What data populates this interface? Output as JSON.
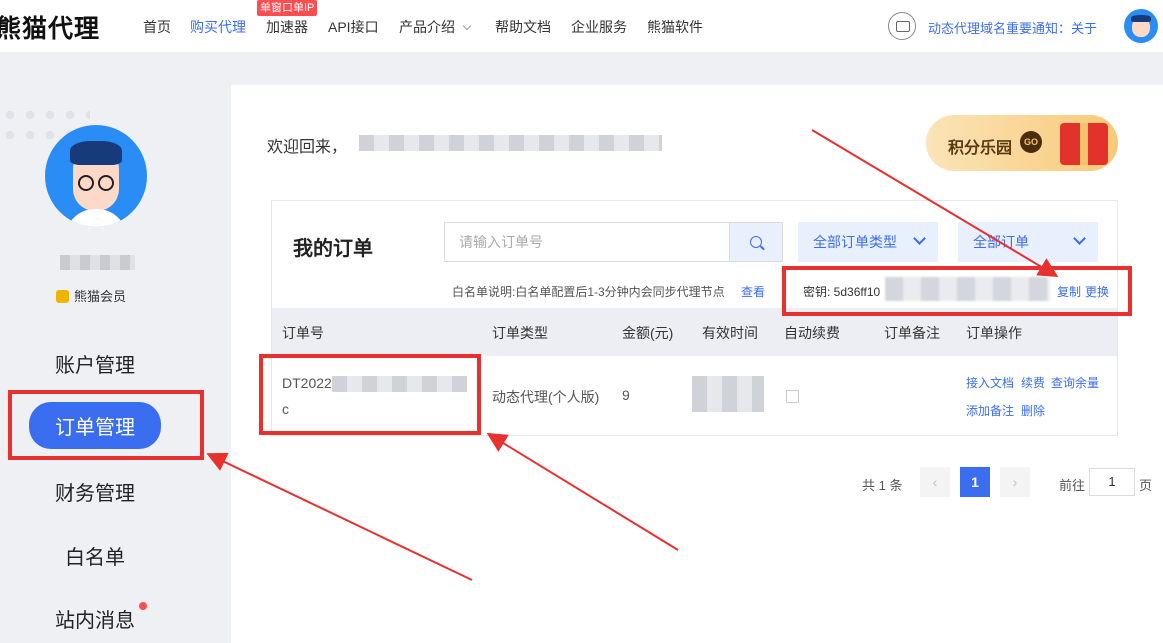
{
  "header": {
    "logo": "熊猫代理",
    "nav": [
      {
        "label": "首页"
      },
      {
        "label": "购买代理"
      },
      {
        "label": "加速器"
      },
      {
        "label": "API接口"
      },
      {
        "label": "产品介绍"
      },
      {
        "label": "帮助文档"
      },
      {
        "label": "企业服务"
      },
      {
        "label": "熊猫软件"
      }
    ],
    "nav_badge": "单窗口单IP",
    "notice": "动态代理域名重要通知：关于",
    "accent_color": "#3a6df0"
  },
  "sidebar": {
    "member_label": "熊猫会员",
    "menu": [
      {
        "label": "账户管理"
      },
      {
        "label": "订单管理"
      },
      {
        "label": "财务管理"
      },
      {
        "label": "白名单"
      },
      {
        "label": "站内消息"
      }
    ]
  },
  "main": {
    "welcome": "欢迎回来，",
    "points_banner": "积分乐园",
    "points_go": "GO",
    "orders": {
      "title": "我的订单",
      "search_placeholder": "请输入订单号",
      "type_filter": "全部订单类型",
      "status_filter": "全部订单",
      "whitelist_note": "白名单说明:白名单配置后1-3分钟内会同步代理节点",
      "view_link": "查看",
      "secret_label": "密钥: 5d36ff10",
      "copy_link": "复制",
      "change_link": "更换",
      "columns": [
        "订单号",
        "订单类型",
        "金额(元)",
        "有效时间",
        "自动续费",
        "订单备注",
        "订单操作"
      ],
      "rows": [
        {
          "order_id_line1": "DT2022",
          "order_id_line2": "c",
          "type": "动态代理(个人版)",
          "amount": "9",
          "actions": [
            "接入文档",
            "续费",
            "查询余量",
            "添加备注",
            "删除"
          ]
        }
      ]
    },
    "pagination": {
      "total": "共 1 条",
      "prev": "‹",
      "current": "1",
      "next": "›",
      "goto_label": "前往",
      "goto_value": "1",
      "goto_suffix": "页"
    }
  }
}
